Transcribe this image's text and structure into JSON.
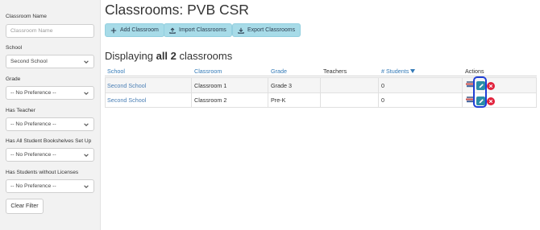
{
  "filters": {
    "classroom_name": {
      "label": "Classroom Name",
      "placeholder": "Classroom Name"
    },
    "school": {
      "label": "School",
      "value": "Second School"
    },
    "grade": {
      "label": "Grade",
      "value": "-- No Preference --"
    },
    "has_teacher": {
      "label": "Has Teacher",
      "value": "-- No Preference --"
    },
    "bookshelves": {
      "label": "Has All Student Bookshelves Set Up",
      "value": "-- No Preference --"
    },
    "licenses": {
      "label": "Has Students without Licenses",
      "value": "-- No Preference --"
    },
    "clear_label": "Clear Filter"
  },
  "page": {
    "title": "Classrooms: PVB CSR",
    "subtitle_prefix": "Displaying ",
    "subtitle_bold": "all 2",
    "subtitle_suffix": " classrooms"
  },
  "toolbar": {
    "add_label": "Add Classroom",
    "import_label": "Import Classrooms",
    "export_label": "Export Classrooms"
  },
  "table": {
    "headers": {
      "school": "School",
      "classroom": "Classroom",
      "grade": "Grade",
      "teachers": "Teachers",
      "students": "# Students",
      "actions": "Actions"
    },
    "sort_column": "students",
    "rows": [
      {
        "school": "Second School",
        "classroom": "Classroom 1",
        "grade": "Grade 3",
        "teachers": "",
        "students": "0"
      },
      {
        "school": "Second School",
        "classroom": "Classroom 2",
        "grade": "Pre-K",
        "teachers": "",
        "students": "0"
      }
    ]
  },
  "icons": {
    "toolbar": [
      "plus-icon",
      "upload-icon",
      "download-icon"
    ],
    "row_actions": [
      "books-icon",
      "edit-icon",
      "delete-icon"
    ],
    "select": "chevron-down-icon"
  },
  "colors": {
    "toolbar_button": "#a7dbe8",
    "link": "#4a7fb5",
    "edit": "#2a8ea8",
    "delete": "#e2233d",
    "highlight": "#1f3fd6"
  }
}
